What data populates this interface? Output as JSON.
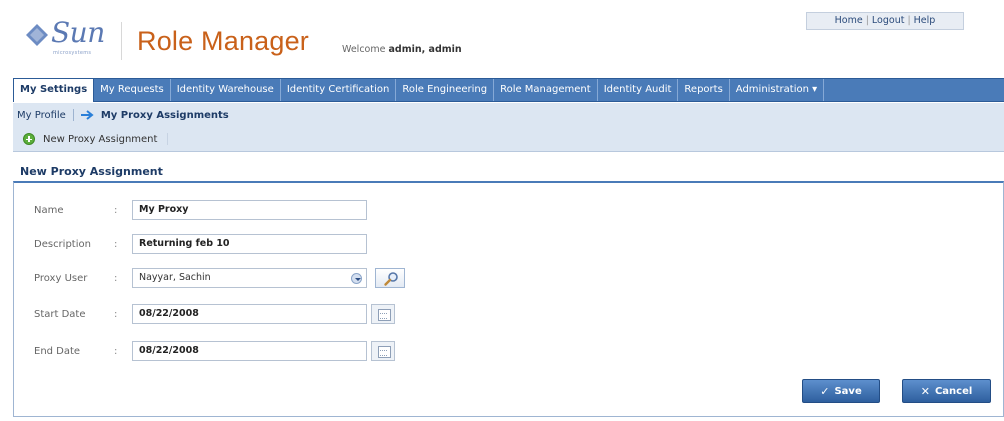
{
  "header": {
    "logo_text": "Sun",
    "logo_sub": "microsystems",
    "app_title": "Role Manager",
    "welcome_prefix": "Welcome",
    "welcome_user": "admin, admin",
    "links": [
      "Home",
      "Logout",
      "Help"
    ]
  },
  "nav": {
    "tabs": [
      {
        "label": "My Settings",
        "active": true
      },
      {
        "label": "My Requests"
      },
      {
        "label": "Identity Warehouse"
      },
      {
        "label": "Identity Certification"
      },
      {
        "label": "Role Engineering"
      },
      {
        "label": "Role Management"
      },
      {
        "label": "Identity Audit"
      },
      {
        "label": "Reports"
      },
      {
        "label": "Administration ▾"
      }
    ]
  },
  "subnav": {
    "my_profile": "My Profile",
    "current": "My Proxy Assignments",
    "action": "New Proxy Assignment"
  },
  "section": {
    "title": "New Proxy Assignment"
  },
  "form": {
    "name_label": "Name",
    "name_value": "My Proxy",
    "description_label": "Description",
    "description_value": "Returning feb 10",
    "proxy_user_label": "Proxy User",
    "proxy_user_value": "Nayyar, Sachin",
    "start_date_label": "Start Date",
    "start_date_value": "08/22/2008",
    "end_date_label": "End Date",
    "end_date_value": "08/22/2008",
    "colon": ":"
  },
  "actions": {
    "save": "Save",
    "cancel": "Cancel"
  },
  "colors": {
    "nav_bg": "#4a7bb8",
    "title_orange": "#c9611a",
    "button_blue": "#2e5f9e"
  }
}
